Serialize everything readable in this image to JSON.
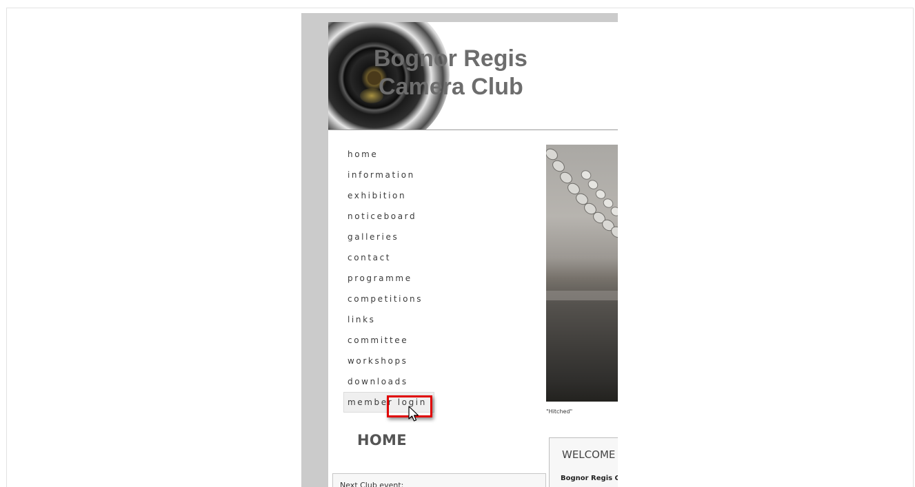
{
  "site": {
    "title_line1": "Bognor Regis",
    "title_line2": "Camera Club"
  },
  "nav": {
    "items": [
      {
        "label": "home"
      },
      {
        "label": "information"
      },
      {
        "label": "exhibition"
      },
      {
        "label": "noticeboard"
      },
      {
        "label": "galleries"
      },
      {
        "label": "contact"
      },
      {
        "label": "programme"
      },
      {
        "label": "competitions"
      },
      {
        "label": "links"
      },
      {
        "label": "committee"
      },
      {
        "label": "workshops"
      },
      {
        "label": "downloads"
      },
      {
        "label": "member login",
        "hovered": true
      }
    ]
  },
  "photo": {
    "caption": "\"Hitched\""
  },
  "page": {
    "heading": "HOME"
  },
  "welcome": {
    "title": "WELCOME",
    "text": "Bognor Regis C"
  },
  "events": {
    "title": "Next Club event:"
  },
  "colors": {
    "highlight": "#e00000",
    "gutter": "#cbcbcb",
    "title_text": "#6d6d6d"
  },
  "icons": {
    "cursor": "arrow-cursor-icon",
    "logo": "camera-lens-icon"
  }
}
